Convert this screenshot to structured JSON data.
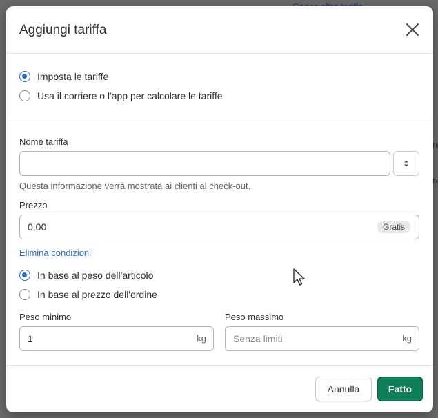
{
  "background": {
    "link_text": "Carica altre tariffe",
    "fragment_a": "re",
    "fragment_b": "ra"
  },
  "modal": {
    "title": "Aggiungi tariffa",
    "rate_type": {
      "options": [
        "Imposta le tariffe",
        "Usa il corriere o l'app per calcolare le tariffe"
      ],
      "selected": 0
    },
    "rate_name": {
      "label": "Nome tariffa",
      "value": "",
      "help": "Questa informazione verrà mostrata ai clienti al check-out."
    },
    "price": {
      "label": "Prezzo",
      "value": "0,00",
      "badge": "Gratis"
    },
    "remove_conditions_link": "Elimina condizioni",
    "condition_type": {
      "options": [
        "In base al peso dell'articolo",
        "In base al prezzo dell'ordine"
      ],
      "selected": 0
    },
    "min_weight": {
      "label": "Peso minimo",
      "value": "1",
      "unit": "kg"
    },
    "max_weight": {
      "label": "Peso massimo",
      "placeholder": "Senza limiti",
      "unit": "kg"
    },
    "footer": {
      "cancel_label": "Annulla",
      "done_label": "Fatto"
    }
  },
  "colors": {
    "accent": "#2c6ecb",
    "primary_button": "#0f7d5a",
    "overlay": "#5f5f5f"
  },
  "icons": {
    "close": "close-icon",
    "stepper": "stepper-icon",
    "cursor": "mouse-cursor-icon"
  }
}
